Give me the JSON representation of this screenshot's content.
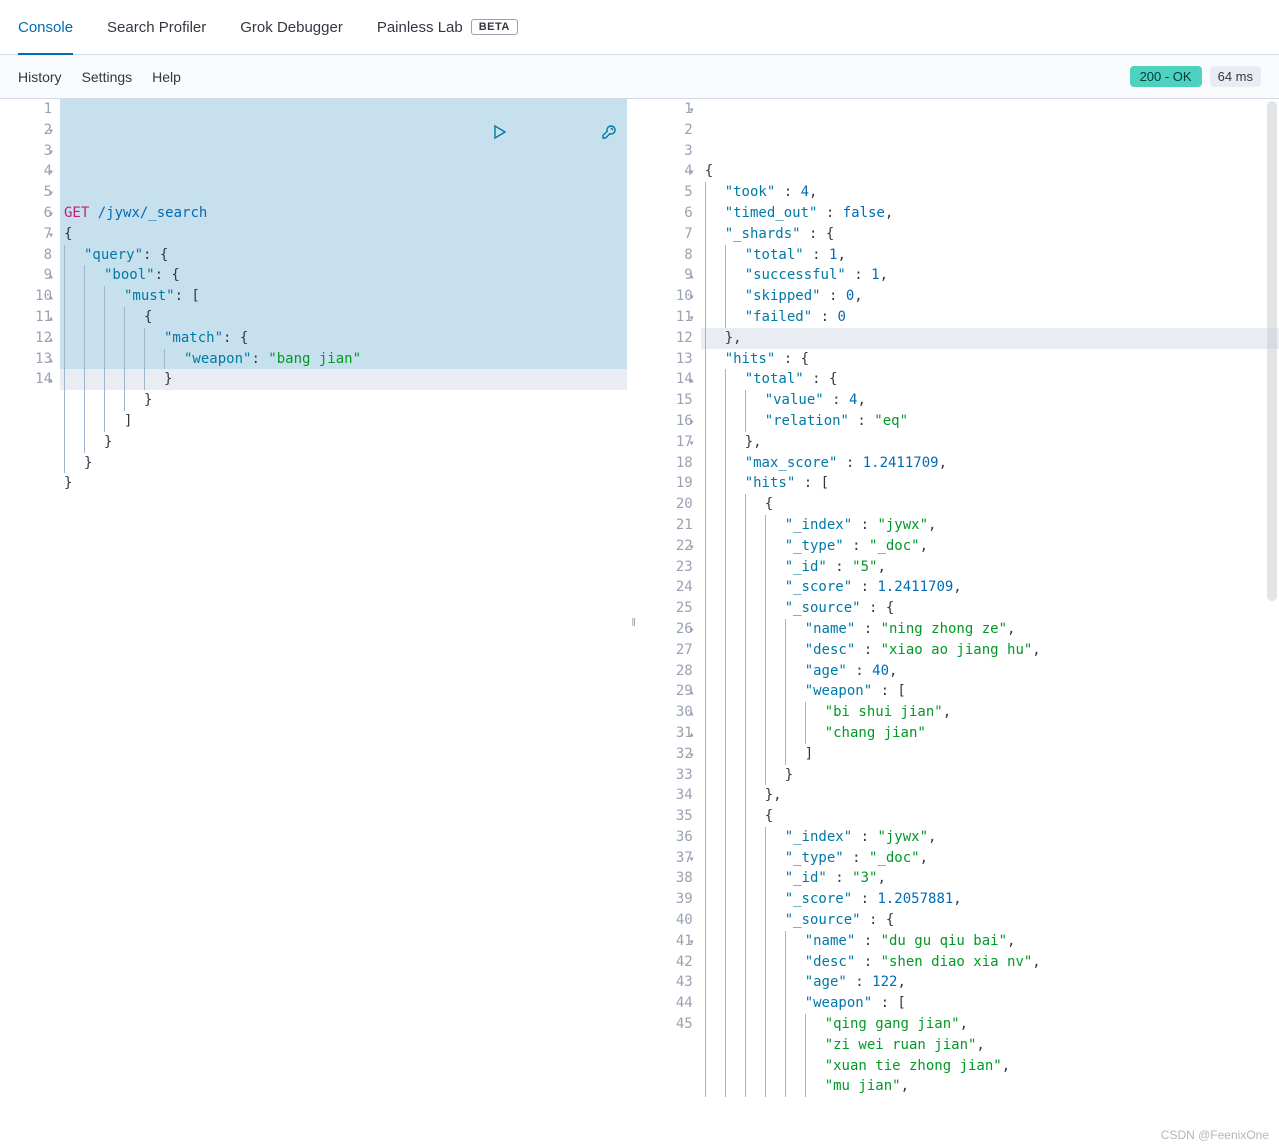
{
  "tabs": {
    "console": "Console",
    "search_profiler": "Search Profiler",
    "grok_debugger": "Grok Debugger",
    "painless_lab": "Painless Lab",
    "beta": "BETA"
  },
  "subbar": {
    "history": "History",
    "settings": "Settings",
    "help": "Help",
    "status": "200 - OK",
    "timing": "64 ms"
  },
  "request": {
    "method": "GET",
    "path": "/jywx/_search",
    "lines": [
      {
        "n": 1
      },
      {
        "n": 2,
        "fold": true,
        "txt": "{"
      },
      {
        "n": 3,
        "fold": true,
        "indent": 1,
        "key": "\"query\"",
        "after": ": {"
      },
      {
        "n": 4,
        "fold": true,
        "indent": 2,
        "key": "\"bool\"",
        "after": ": {"
      },
      {
        "n": 5,
        "fold": true,
        "indent": 3,
        "key": "\"must\"",
        "after": ": ["
      },
      {
        "n": 6,
        "fold": true,
        "indent": 4,
        "txt": "{"
      },
      {
        "n": 7,
        "fold": true,
        "indent": 5,
        "key": "\"match\"",
        "after": ": {"
      },
      {
        "n": 8,
        "indent": 6,
        "key": "\"weapon\"",
        "after": ": ",
        "str": "\"bang jian\""
      },
      {
        "n": 9,
        "fold": true,
        "up": true,
        "indent": 5,
        "txt": "}"
      },
      {
        "n": 10,
        "fold": true,
        "up": true,
        "indent": 4,
        "txt": "}"
      },
      {
        "n": 11,
        "fold": true,
        "up": true,
        "indent": 3,
        "txt": "]"
      },
      {
        "n": 12,
        "fold": true,
        "up": true,
        "indent": 2,
        "txt": "}"
      },
      {
        "n": 13,
        "fold": true,
        "up": true,
        "indent": 1,
        "txt": "}"
      },
      {
        "n": 14,
        "fold": true,
        "up": true,
        "txt": "}"
      }
    ]
  },
  "response": {
    "highlighted_line": 12,
    "lines": [
      {
        "n": 1,
        "fold": true,
        "txt": "{"
      },
      {
        "n": 2,
        "indent": 1,
        "key": "\"took\"",
        "after": " : ",
        "num": "4",
        "comma": true
      },
      {
        "n": 3,
        "indent": 1,
        "key": "\"timed_out\"",
        "after": " : ",
        "bool": "false",
        "comma": true
      },
      {
        "n": 4,
        "fold": true,
        "indent": 1,
        "key": "\"_shards\"",
        "after": " : {"
      },
      {
        "n": 5,
        "indent": 2,
        "key": "\"total\"",
        "after": " : ",
        "num": "1",
        "comma": true
      },
      {
        "n": 6,
        "indent": 2,
        "key": "\"successful\"",
        "after": " : ",
        "num": "1",
        "comma": true
      },
      {
        "n": 7,
        "indent": 2,
        "key": "\"skipped\"",
        "after": " : ",
        "num": "0",
        "comma": true
      },
      {
        "n": 8,
        "indent": 2,
        "key": "\"failed\"",
        "after": " : ",
        "num": "0"
      },
      {
        "n": 9,
        "fold": true,
        "up": true,
        "indent": 1,
        "txt": "},"
      },
      {
        "n": 10,
        "fold": true,
        "indent": 1,
        "key": "\"hits\"",
        "after": " : {"
      },
      {
        "n": 11,
        "fold": true,
        "indent": 2,
        "key": "\"total\"",
        "after": " : {"
      },
      {
        "n": 12,
        "indent": 3,
        "key": "\"value\"",
        "after": " : ",
        "num": "4",
        "comma": true
      },
      {
        "n": 13,
        "indent": 3,
        "key": "\"relation\"",
        "after": " : ",
        "str": "\"eq\""
      },
      {
        "n": 14,
        "fold": true,
        "up": true,
        "indent": 2,
        "txt": "},"
      },
      {
        "n": 15,
        "indent": 2,
        "key": "\"max_score\"",
        "after": " : ",
        "num": "1.2411709",
        "comma": true
      },
      {
        "n": 16,
        "fold": true,
        "indent": 2,
        "key": "\"hits\"",
        "after": " : ["
      },
      {
        "n": 17,
        "fold": true,
        "indent": 3,
        "txt": "{"
      },
      {
        "n": 18,
        "indent": 4,
        "key": "\"_index\"",
        "after": " : ",
        "str": "\"jywx\"",
        "comma": true
      },
      {
        "n": 19,
        "indent": 4,
        "key": "\"_type\"",
        "after": " : ",
        "str": "\"_doc\"",
        "comma": true
      },
      {
        "n": 20,
        "indent": 4,
        "key": "\"_id\"",
        "after": " : ",
        "str": "\"5\"",
        "comma": true
      },
      {
        "n": 21,
        "indent": 4,
        "key": "\"_score\"",
        "after": " : ",
        "num": "1.2411709",
        "comma": true
      },
      {
        "n": 22,
        "fold": true,
        "indent": 4,
        "key": "\"_source\"",
        "after": " : {"
      },
      {
        "n": 23,
        "indent": 5,
        "key": "\"name\"",
        "after": " : ",
        "str": "\"ning zhong ze\"",
        "comma": true
      },
      {
        "n": 24,
        "indent": 5,
        "key": "\"desc\"",
        "after": " : ",
        "str": "\"xiao ao jiang hu\"",
        "comma": true
      },
      {
        "n": 25,
        "indent": 5,
        "key": "\"age\"",
        "after": " : ",
        "num": "40",
        "comma": true
      },
      {
        "n": 26,
        "fold": true,
        "indent": 5,
        "key": "\"weapon\"",
        "after": " : ["
      },
      {
        "n": 27,
        "indent": 6,
        "str": "\"bi shui jian\"",
        "comma": true
      },
      {
        "n": 28,
        "indent": 6,
        "str": "\"chang jian\""
      },
      {
        "n": 29,
        "fold": true,
        "up": true,
        "indent": 5,
        "txt": "]"
      },
      {
        "n": 30,
        "fold": true,
        "up": true,
        "indent": 4,
        "txt": "}"
      },
      {
        "n": 31,
        "fold": true,
        "up": true,
        "indent": 3,
        "txt": "},"
      },
      {
        "n": 32,
        "fold": true,
        "indent": 3,
        "txt": "{"
      },
      {
        "n": 33,
        "indent": 4,
        "key": "\"_index\"",
        "after": " : ",
        "str": "\"jywx\"",
        "comma": true
      },
      {
        "n": 34,
        "indent": 4,
        "key": "\"_type\"",
        "after": " : ",
        "str": "\"_doc\"",
        "comma": true
      },
      {
        "n": 35,
        "indent": 4,
        "key": "\"_id\"",
        "after": " : ",
        "str": "\"3\"",
        "comma": true
      },
      {
        "n": 36,
        "indent": 4,
        "key": "\"_score\"",
        "after": " : ",
        "num": "1.2057881",
        "comma": true
      },
      {
        "n": 37,
        "fold": true,
        "indent": 4,
        "key": "\"_source\"",
        "after": " : {"
      },
      {
        "n": 38,
        "indent": 5,
        "key": "\"name\"",
        "after": " : ",
        "str": "\"du gu qiu bai\"",
        "comma": true
      },
      {
        "n": 39,
        "indent": 5,
        "key": "\"desc\"",
        "after": " : ",
        "str": "\"shen diao xia nv\"",
        "comma": true
      },
      {
        "n": 40,
        "indent": 5,
        "key": "\"age\"",
        "after": " : ",
        "num": "122",
        "comma": true
      },
      {
        "n": 41,
        "fold": true,
        "indent": 5,
        "key": "\"weapon\"",
        "after": " : ["
      },
      {
        "n": 42,
        "indent": 6,
        "str": "\"qing gang jian\"",
        "comma": true
      },
      {
        "n": 43,
        "indent": 6,
        "str": "\"zi wei ruan jian\"",
        "comma": true
      },
      {
        "n": 44,
        "indent": 6,
        "str": "\"xuan tie zhong jian\"",
        "comma": true
      },
      {
        "n": 45,
        "indent": 6,
        "str": "\"mu jian\"",
        "comma": true
      }
    ]
  },
  "watermark": "CSDN @FeenixOne"
}
